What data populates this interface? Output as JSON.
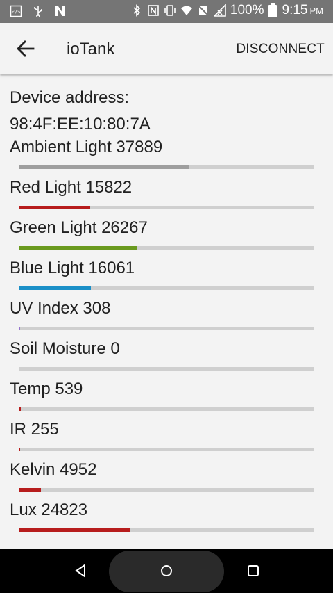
{
  "status_bar": {
    "battery_text": "100%",
    "time": "9:15",
    "ampm": "PM",
    "icons": [
      "code-icon",
      "usb-icon",
      "notification-n-icon",
      "bluetooth-icon",
      "nfc-icon",
      "vibrate-icon",
      "wifi-icon",
      "do-not-disturb-icon",
      "signal-icon",
      "battery-icon"
    ]
  },
  "app_bar": {
    "title": "ioTank",
    "action": "DISCONNECT"
  },
  "device": {
    "label": "Device address:",
    "address": "98:4F:EE:10:80:7A"
  },
  "readings": [
    {
      "label": "Ambient Light 37889",
      "fraction": 0.578,
      "color": "#9e9e9e"
    },
    {
      "label": "Red Light 15822",
      "fraction": 0.241,
      "color": "#b71c1c"
    },
    {
      "label": "Green Light 26267",
      "fraction": 0.401,
      "color": "#6a9a1f"
    },
    {
      "label": "Blue Light 16061",
      "fraction": 0.245,
      "color": "#1b8fc7"
    },
    {
      "label": "UV Index 308",
      "fraction": 0.005,
      "color": "#9575cd"
    },
    {
      "label": "Soil Moisture 0",
      "fraction": 0.0,
      "color": "#795548"
    },
    {
      "label": "Temp 539",
      "fraction": 0.008,
      "color": "#b71c1c"
    },
    {
      "label": "IR 255",
      "fraction": 0.004,
      "color": "#b71c1c"
    },
    {
      "label": "Kelvin 4952",
      "fraction": 0.075,
      "color": "#b71c1c"
    },
    {
      "label": "Lux 24823",
      "fraction": 0.379,
      "color": "#b71c1c"
    }
  ]
}
